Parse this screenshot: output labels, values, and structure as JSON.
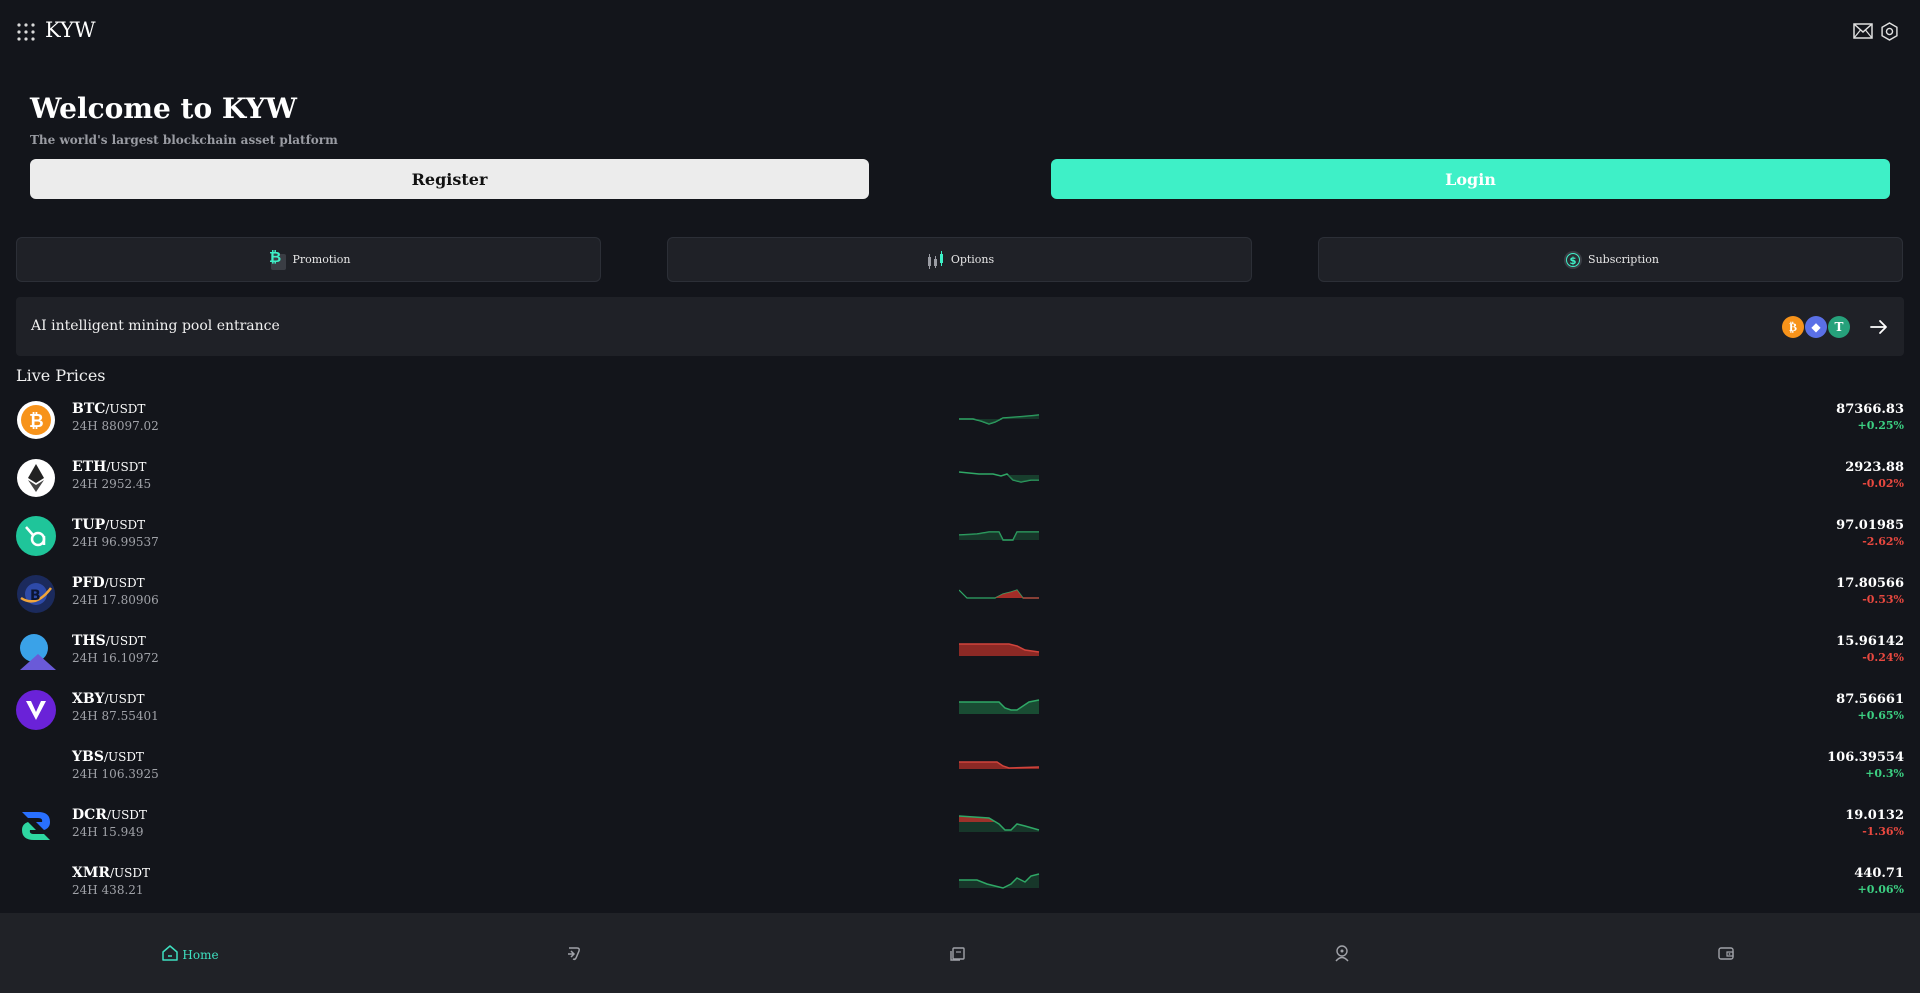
{
  "header": {
    "brand": "KYW",
    "icons": [
      "menu-grid-icon",
      "mail-icon",
      "settings-icon"
    ]
  },
  "hero": {
    "title": "Welcome to KYW",
    "subtitle": "The world's largest blockchain asset platform",
    "register_label": "Register",
    "login_label": "Login"
  },
  "quick_links": [
    {
      "label": "Promotion",
      "icon": "bitcoin-promo-icon"
    },
    {
      "label": "Options",
      "icon": "candlestick-icon"
    },
    {
      "label": "Subscription",
      "icon": "dollar-coin-icon"
    }
  ],
  "mining": {
    "label": "AI intelligent mining pool entrance",
    "coins": [
      "btc",
      "eth",
      "usdt"
    ]
  },
  "live_prices": {
    "title": "Live Prices",
    "rows": [
      {
        "symbol": "BTC",
        "quote": "/USDT",
        "h24": "24H 88097.02",
        "price": "87366.83",
        "change": "+0.25%",
        "dir": "up"
      },
      {
        "symbol": "ETH",
        "quote": "/USDT",
        "h24": "24H 2952.45",
        "price": "2923.88",
        "change": "-0.02%",
        "dir": "down"
      },
      {
        "symbol": "TUP",
        "quote": "/USDT",
        "h24": "24H 96.99537",
        "price": "97.01985",
        "change": "-2.62%",
        "dir": "down"
      },
      {
        "symbol": "PFD",
        "quote": "/USDT",
        "h24": "24H 17.80906",
        "price": "17.80566",
        "change": "-0.53%",
        "dir": "down"
      },
      {
        "symbol": "THS",
        "quote": "/USDT",
        "h24": "24H 16.10972",
        "price": "15.96142",
        "change": "-0.24%",
        "dir": "down"
      },
      {
        "symbol": "XBY",
        "quote": "/USDT",
        "h24": "24H 87.55401",
        "price": "87.56661",
        "change": "+0.65%",
        "dir": "up"
      },
      {
        "symbol": "YBS",
        "quote": "/USDT",
        "h24": "24H 106.3925",
        "price": "106.39554",
        "change": "+0.3%",
        "dir": "up"
      },
      {
        "symbol": "DCR",
        "quote": "/USDT",
        "h24": "24H 15.949",
        "price": "19.0132",
        "change": "-1.36%",
        "dir": "down"
      },
      {
        "symbol": "XMR",
        "quote": "/USDT",
        "h24": "24H 438.21",
        "price": "440.71",
        "change": "+0.06%",
        "dir": "up"
      }
    ]
  },
  "bottom_nav": {
    "home_label": "Home",
    "items": [
      "home-icon",
      "trade-icon",
      "markets-icon",
      "support-icon",
      "wallet-icon"
    ]
  },
  "colors": {
    "background": "#13151b",
    "accent": "#3ef0c7",
    "up": "#3ccf82",
    "down": "#e8483f"
  }
}
